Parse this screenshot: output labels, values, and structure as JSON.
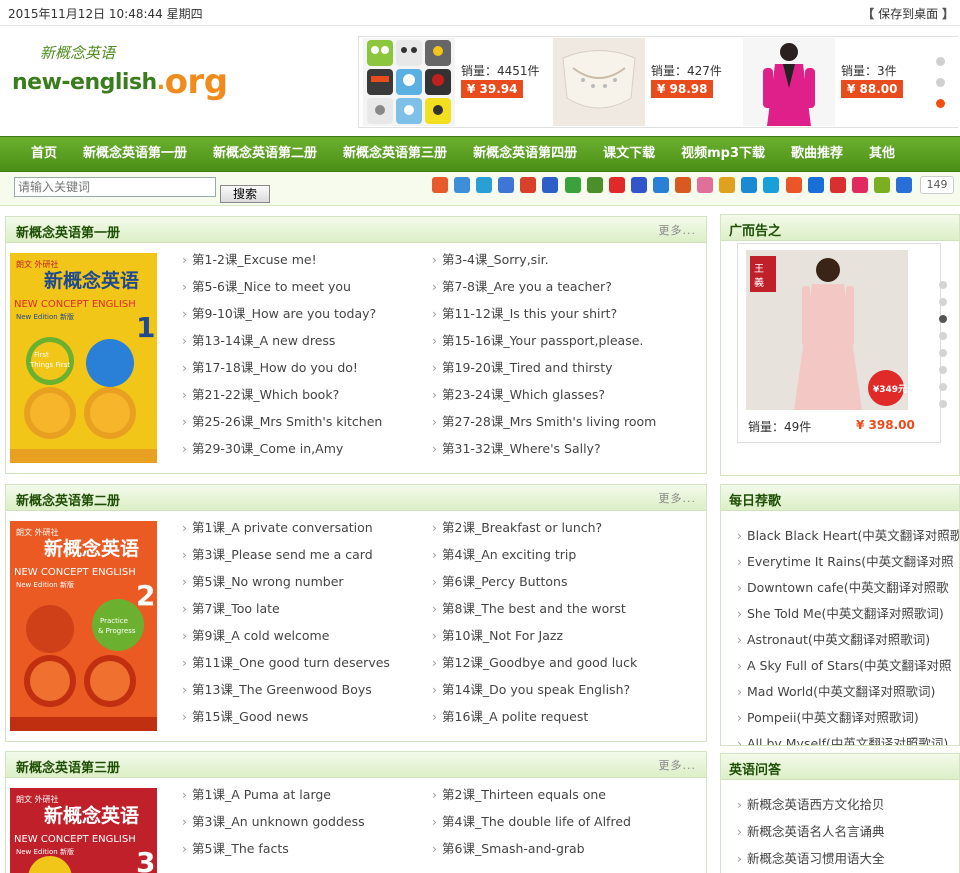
{
  "topbar": {
    "datetime": "2015年11月12日  10:48:44 星期四",
    "save_desktop": "保存到桌面"
  },
  "logo": {
    "cn": "新概念英语",
    "en_main": "new-english",
    "en_dot": ".",
    "en_tld": "org"
  },
  "products": [
    {
      "sales": "销量：4451件",
      "price": "¥ 39.94"
    },
    {
      "sales": "销量：427件",
      "price": "¥ 98.98"
    },
    {
      "sales": "销量：3件",
      "price": "¥ 88.00"
    }
  ],
  "nav": [
    "首页",
    "新概念英语第一册",
    "新概念英语第二册",
    "新概念英语第三册",
    "新概念英语第四册",
    "课文下载",
    "视频mp3下载",
    "歌曲推荐",
    "其他"
  ],
  "search": {
    "placeholder": "请输入关键词",
    "button": "搜索"
  },
  "share_count": "149",
  "share_colors": [
    "#e85a2b",
    "#3c8fd8",
    "#2a9fd6",
    "#3f76d6",
    "#d8402b",
    "#2d5fc6",
    "#3aa23a",
    "#4a8f2a",
    "#e02a2a",
    "#3355cc",
    "#2a7fd6",
    "#d85a20",
    "#e0709a",
    "#e0a020",
    "#1a8ad4",
    "#1aa0d8",
    "#e8562a",
    "#1a6fd6",
    "#d83030",
    "#e02a60",
    "#7ab020",
    "#2a6fd8"
  ],
  "sections": [
    {
      "title": "新概念英语第一册",
      "more": "更多...",
      "cover": {
        "pub": "朗文 外研社",
        "title": "新概念英语",
        "en": "NEW CONCEPT ENGLISH",
        "edition": "New Edition 新版",
        "num": "1",
        "sub": "First Things First 英语初阶",
        "color": "#f2c619"
      },
      "lessons": [
        "第1-2课_Excuse me!",
        "第3-4课_Sorry,sir.",
        "第5-6课_Nice to meet you",
        "第7-8课_Are you a teacher?",
        "第9-10课_How are you today?",
        "第11-12课_Is this your shirt?",
        "第13-14课_A new dress",
        "第15-16课_Your passport,please.",
        "第17-18课_How do you do!",
        "第19-20课_Tired and thirsty",
        "第21-22课_Which book?",
        "第23-24课_Which glasses?",
        "第25-26课_Mrs Smith's kitchen",
        "第27-28课_Mrs Smith's living room",
        "第29-30课_Come in,Amy",
        "第31-32课_Where's Sally?"
      ]
    },
    {
      "title": "新概念英语第二册",
      "more": "更多...",
      "cover": {
        "pub": "朗文 外研社",
        "title": "新概念英语",
        "en": "NEW CONCEPT ENGLISH",
        "edition": "New Edition 新版",
        "num": "2",
        "sub": "Practice & Progress 实践与进步",
        "color": "#ea5a22"
      },
      "lessons": [
        "第1课_A private conversation",
        "第2课_Breakfast or lunch?",
        "第3课_Please send me a card",
        "第4课_An exciting trip",
        "第5课_No wrong number",
        "第6课_Percy Buttons",
        "第7课_Too late",
        "第8课_The best and the worst",
        "第9课_A cold welcome",
        "第10课_Not For Jazz",
        "第11课_One good turn deserves",
        "第12课_Goodbye and good luck",
        "第13课_The Greenwood Boys",
        "第14课_Do you speak English?",
        "第15课_Good news",
        "第16课_A polite request"
      ]
    },
    {
      "title": "新概念英语第三册",
      "more": "更多...",
      "cover": {
        "pub": "朗文 外研社",
        "title": "新概念英语",
        "en": "NEW CONCEPT ENGLISH",
        "edition": "New Edition 新版",
        "num": "3",
        "sub": "",
        "color": "#c0202a"
      },
      "lessons": [
        "第1课_A Puma at large",
        "第2课_Thirteen equals one",
        "第3课_An unknown goddess",
        "第4课_The double life of Alfred",
        "第5课_The facts",
        "第6课_Smash-and-grab"
      ]
    }
  ],
  "sidebar": {
    "ad": {
      "title": "广而告之",
      "sales": "销量：49件",
      "price": "¥ 398.00",
      "badge": "¥349元"
    },
    "songs": {
      "title": "每日荐歌",
      "items": [
        "Black Black Heart(中英文翻译对照歌",
        "Everytime It Rains(中英文翻译对照",
        "Downtown cafe(中英文翻译对照歌",
        "She Told Me(中英文翻译对照歌词)",
        "Astronaut(中英文翻译对照歌词)",
        "A Sky Full of Stars(中英文翻译对照",
        "Mad World(中英文翻译对照歌词)",
        "Pompeii(中英文翻译对照歌词)",
        "All by Myself(中英文翻译对照歌词)"
      ]
    },
    "qa": {
      "title": "英语问答",
      "items": [
        "新概念英语西方文化拾贝",
        "新概念英语名人名言诵典",
        "新概念英语习惯用语大全"
      ]
    }
  }
}
